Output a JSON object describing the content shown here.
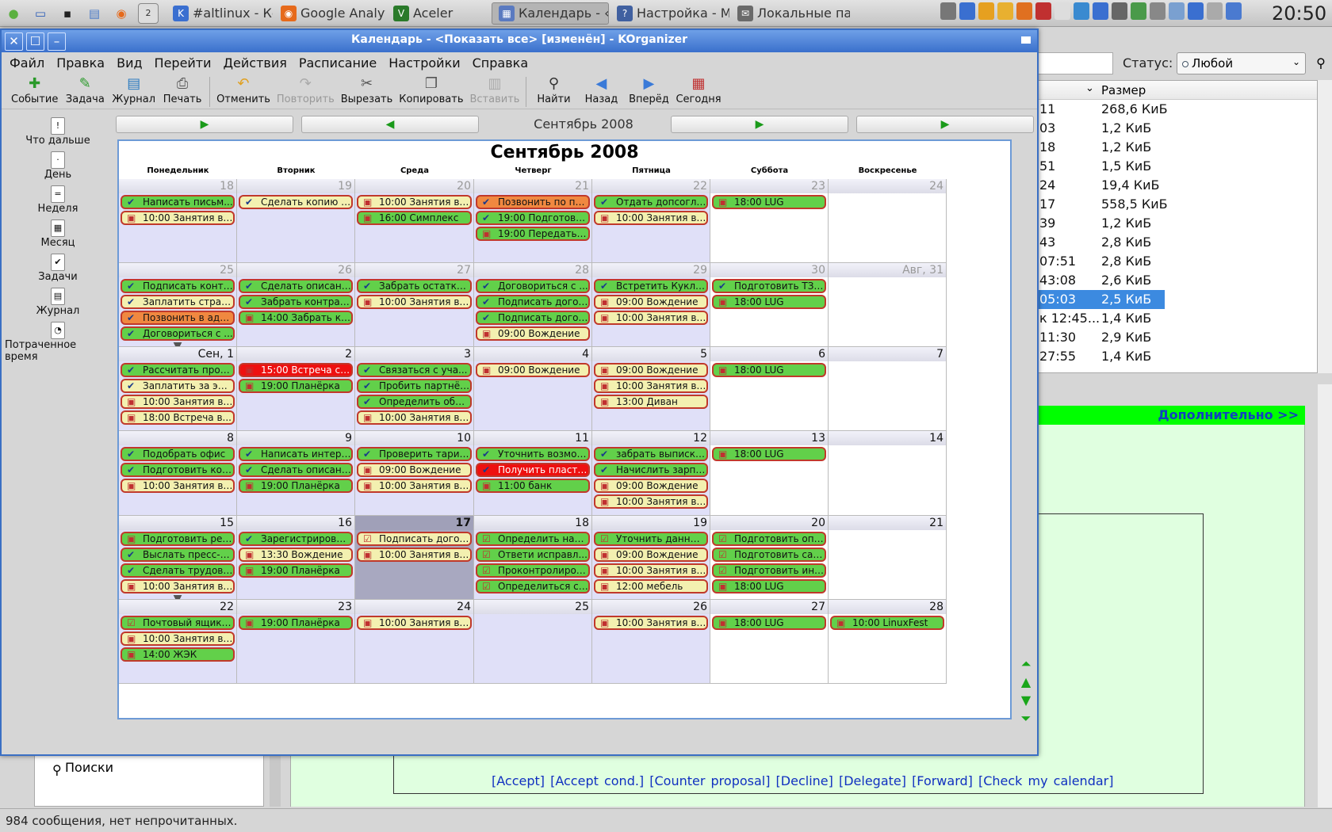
{
  "taskbar": {
    "tasks": [
      {
        "label": "#altlinux - Ко",
        "color": "#3a6fd0",
        "glyph": "K"
      },
      {
        "label": "Google Analyti",
        "color": "#e66a1b",
        "glyph": "◉"
      },
      {
        "label": "Aceler",
        "color": "#2a7a2a",
        "glyph": "V"
      },
      {
        "label": "Календарь - ‹",
        "color": "#5a7ac0",
        "glyph": "▦"
      },
      {
        "label": "Настройка - М",
        "color": "#4060a0",
        "glyph": "?"
      },
      {
        "label": "Локальные па",
        "color": "#6a6a6a",
        "glyph": "✉"
      }
    ],
    "launchers": [
      {
        "name": "os-logo-icon",
        "glyph": "●",
        "color": "#5bb040"
      },
      {
        "name": "desktop-icon",
        "glyph": "▭",
        "color": "#2b5db8"
      },
      {
        "name": "terminal-icon",
        "glyph": "▪",
        "color": "#222"
      },
      {
        "name": "files-icon",
        "glyph": "▤",
        "color": "#4a7ac8"
      },
      {
        "name": "browser-icon",
        "glyph": "◉",
        "color": "#e66a1b"
      }
    ],
    "pager_number": "2",
    "clock": "20:50"
  },
  "background": {
    "status_label": "Статус:",
    "status_value": "Любой",
    "size_header": "Размер",
    "rows": [
      {
        "c1": "11",
        "c2": "268,6 КиБ"
      },
      {
        "c1": "03",
        "c2": "1,2 КиБ"
      },
      {
        "c1": "18",
        "c2": "1,2 КиБ"
      },
      {
        "c1": "51",
        "c2": "1,5 КиБ"
      },
      {
        "c1": "24",
        "c2": "19,4 КиБ"
      },
      {
        "c1": "17",
        "c2": "558,5 КиБ"
      },
      {
        "c1": "39",
        "c2": "1,2 КиБ"
      },
      {
        "c1": "43",
        "c2": "2,8 КиБ"
      },
      {
        "c1": "07:51",
        "c2": "2,8 КиБ"
      },
      {
        "c1": "43:08",
        "c2": "2,6 КиБ"
      },
      {
        "c1": "05:03",
        "c2": "2,5 КиБ",
        "selected": true
      },
      {
        "c1": "к 12:45...",
        "c2": "1,4 КиБ"
      },
      {
        "c1": "11:30",
        "c2": "2,9 КиБ"
      },
      {
        "c1": "27:55",
        "c2": "1,4 КиБ"
      }
    ],
    "more_link": "Дополнительно >>",
    "actions": "[Accept]  [Accept cond.]  [Counter proposal]  [Decline]  [Delegate]  [Forward]  [Check my calendar]",
    "folder": "Поиски",
    "statusbar": "984 сообщения, нет непрочитанных."
  },
  "window": {
    "title": "Календарь - <Показать все>  [изменён] - KOrganizer",
    "menu": [
      "Файл",
      "Правка",
      "Вид",
      "Перейти",
      "Действия",
      "Расписание",
      "Настройки",
      "Справка"
    ],
    "toolbar": [
      {
        "label": "Событие",
        "icon": "✚",
        "color": "#2a9a2a"
      },
      {
        "label": "Задача",
        "icon": "✎",
        "color": "#2a9a2a"
      },
      {
        "label": "Журнал",
        "icon": "▤",
        "color": "#2a7ac0"
      },
      {
        "label": "Печать",
        "icon": "⎙",
        "color": "#555"
      },
      {
        "sep": true
      },
      {
        "label": "Отменить",
        "icon": "↶",
        "color": "#e0a020"
      },
      {
        "label": "Повторить",
        "icon": "↷",
        "color": "#aaa",
        "disabled": true
      },
      {
        "label": "Вырезать",
        "icon": "✂",
        "color": "#555"
      },
      {
        "label": "Копировать",
        "icon": "❐",
        "color": "#555"
      },
      {
        "label": "Вставить",
        "icon": "▥",
        "color": "#aaa",
        "disabled": true
      },
      {
        "sep": true
      },
      {
        "label": "Найти",
        "icon": "⚲",
        "color": "#333"
      },
      {
        "label": "Назад",
        "icon": "◀",
        "color": "#3a7ad8"
      },
      {
        "label": "Вперёд",
        "icon": "▶",
        "color": "#3a7ad8"
      },
      {
        "label": "Сегодня",
        "icon": "▦",
        "color": "#c03030"
      }
    ],
    "sidebar": [
      {
        "label": "Что дальше",
        "glyph": "!"
      },
      {
        "label": "День",
        "glyph": "·"
      },
      {
        "label": "Неделя",
        "glyph": "="
      },
      {
        "label": "Месяц",
        "glyph": "▦"
      },
      {
        "label": "Задачи",
        "glyph": "✔"
      },
      {
        "label": "Журнал",
        "glyph": "▤"
      },
      {
        "label": "Потраченное время",
        "glyph": "◔"
      }
    ],
    "nav_month": "Сентябрь 2008",
    "calendar_title": "Сентябрь 2008",
    "day_names": [
      "Понедельник",
      "Вторник",
      "Среда",
      "Четверг",
      "Пятница",
      "Суббота",
      "Воскресенье"
    ],
    "weeks": [
      [
        {
          "d": "18",
          "prev": true,
          "ev": [
            [
              "g",
              "t",
              "Написать письм..."
            ],
            [
              "y",
              "e",
              "10:00 Занятия в ..."
            ]
          ]
        },
        {
          "d": "19",
          "prev": true,
          "ev": [
            [
              "y",
              "t",
              "Сделать копию с..."
            ]
          ]
        },
        {
          "d": "20",
          "prev": true,
          "ev": [
            [
              "y",
              "e",
              "10:00 Занятия в ..."
            ],
            [
              "g",
              "e",
              "16:00 Симплекс"
            ]
          ]
        },
        {
          "d": "21",
          "prev": true,
          "ev": [
            [
              "o",
              "t",
              "Позвонить по по..."
            ],
            [
              "g",
              "t",
              "19:00 Подготовит..."
            ],
            [
              "g",
              "e",
              "19:00 Передать ..."
            ]
          ]
        },
        {
          "d": "22",
          "prev": true,
          "ev": [
            [
              "g",
              "t",
              "Отдать допсогла..."
            ],
            [
              "y",
              "e",
              "10:00 Занятия в ..."
            ]
          ]
        },
        {
          "d": "23",
          "prev": true,
          "we": true,
          "ev": [
            [
              "g",
              "e",
              "18:00 LUG"
            ]
          ]
        },
        {
          "d": "24",
          "prev": true,
          "we": true,
          "ev": []
        }
      ],
      [
        {
          "d": "25",
          "prev": true,
          "ev": [
            [
              "g",
              "t",
              "Подписать контр..."
            ],
            [
              "y",
              "t",
              "Заплатить страх..."
            ],
            [
              "o",
              "t",
              "Позвонить в адм..."
            ],
            [
              "g",
              "t",
              "Договориться с ..."
            ]
          ],
          "more": true
        },
        {
          "d": "26",
          "prev": true,
          "ev": [
            [
              "g",
              "t",
              "Сделать описани..."
            ],
            [
              "g",
              "t",
              "Забрать контракт..."
            ],
            [
              "g",
              "e",
              "14:00 Забрать ко..."
            ]
          ]
        },
        {
          "d": "27",
          "prev": true,
          "ev": [
            [
              "g",
              "t",
              "Забрать остатки ..."
            ],
            [
              "y",
              "e",
              "10:00 Занятия в ..."
            ]
          ]
        },
        {
          "d": "28",
          "prev": true,
          "ev": [
            [
              "g",
              "t",
              "Договориться с ..."
            ],
            [
              "g",
              "t",
              "Подписать догов..."
            ],
            [
              "g",
              "t",
              "Подписать догов..."
            ],
            [
              "y",
              "e",
              "09:00 Вождение"
            ]
          ]
        },
        {
          "d": "29",
          "prev": true,
          "ev": [
            [
              "g",
              "t",
              "Встретить Куклина"
            ],
            [
              "y",
              "e",
              "09:00 Вождение"
            ],
            [
              "y",
              "e",
              "10:00 Занятия в ..."
            ]
          ]
        },
        {
          "d": "30",
          "prev": true,
          "we": true,
          "ev": [
            [
              "g",
              "t",
              "Подготовить ТЗ ..."
            ],
            [
              "g",
              "e",
              "18:00 LUG"
            ]
          ]
        },
        {
          "d": "Авг, 31",
          "prev": true,
          "we": true,
          "ev": []
        }
      ],
      [
        {
          "d": "Сен, 1",
          "ev": [
            [
              "g",
              "t",
              "Рассчитать прое..."
            ],
            [
              "y",
              "t",
              "Заплатить за эле..."
            ],
            [
              "y",
              "e",
              "10:00 Занятия в ..."
            ],
            [
              "y",
              "e",
              "18:00 Встреча в..."
            ]
          ]
        },
        {
          "d": "2",
          "ev": [
            [
              "r",
              "e",
              "15:00 Встреча с ..."
            ],
            [
              "g",
              "e",
              "19:00 Планёрка"
            ]
          ]
        },
        {
          "d": "3",
          "ev": [
            [
              "g",
              "t",
              "Связаться с уча..."
            ],
            [
              "g",
              "t",
              "Пробить партнёр..."
            ],
            [
              "g",
              "t",
              "Определить объ..."
            ],
            [
              "y",
              "e",
              "10:00 Занятия в ..."
            ]
          ]
        },
        {
          "d": "4",
          "ev": [
            [
              "y",
              "e",
              "09:00 Вождение"
            ]
          ]
        },
        {
          "d": "5",
          "ev": [
            [
              "y",
              "e",
              "09:00 Вождение"
            ],
            [
              "y",
              "e",
              "10:00 Занятия в ..."
            ],
            [
              "y",
              "e",
              "13:00 Диван"
            ]
          ]
        },
        {
          "d": "6",
          "we": true,
          "ev": [
            [
              "g",
              "e",
              "18:00 LUG"
            ]
          ]
        },
        {
          "d": "7",
          "we": true,
          "ev": []
        }
      ],
      [
        {
          "d": "8",
          "ev": [
            [
              "g",
              "t",
              "Подобрать офис"
            ],
            [
              "g",
              "t",
              "Подготовить конт..."
            ],
            [
              "y",
              "e",
              "10:00 Занятия в ..."
            ]
          ]
        },
        {
          "d": "9",
          "ev": [
            [
              "g",
              "t",
              "Написать интервью"
            ],
            [
              "g",
              "t",
              "Сделать описани..."
            ],
            [
              "g",
              "e",
              "19:00 Планёрка"
            ]
          ]
        },
        {
          "d": "10",
          "ev": [
            [
              "g",
              "t",
              "Проверить тариф..."
            ],
            [
              "y",
              "e",
              "09:00 Вождение"
            ],
            [
              "y",
              "e",
              "10:00 Занятия в ..."
            ]
          ]
        },
        {
          "d": "11",
          "ev": [
            [
              "g",
              "t",
              "Уточнить возмож..."
            ],
            [
              "r",
              "t",
              "Получить пласти..."
            ],
            [
              "g",
              "e",
              "11:00 банк"
            ]
          ]
        },
        {
          "d": "12",
          "ev": [
            [
              "g",
              "t",
              "забрать выписки..."
            ],
            [
              "g",
              "t",
              "Начислить зарпл..."
            ],
            [
              "y",
              "e",
              "09:00 Вождение"
            ],
            [
              "y",
              "e",
              "10:00 Занятия в ..."
            ]
          ]
        },
        {
          "d": "13",
          "we": true,
          "ev": [
            [
              "g",
              "e",
              "18:00 LUG"
            ]
          ]
        },
        {
          "d": "14",
          "we": true,
          "ev": []
        }
      ],
      [
        {
          "d": "15",
          "ev": [
            [
              "g",
              "e",
              "Подготовить реш..."
            ],
            [
              "g",
              "t",
              "Выслать пресс-р..."
            ],
            [
              "g",
              "t",
              "Сделать трудово..."
            ],
            [
              "y",
              "e",
              "10:00 Занятия в ..."
            ]
          ],
          "more": true
        },
        {
          "d": "16",
          "ev": [
            [
              "g",
              "t",
              "Зарегистрироват..."
            ],
            [
              "y",
              "e",
              "13:30 Вождение"
            ],
            [
              "g",
              "e",
              "19:00 Планёрка"
            ]
          ]
        },
        {
          "d": "17",
          "today": true,
          "ev": [
            [
              "y",
              "c",
              "Подписать догов..."
            ],
            [
              "y",
              "e",
              "10:00 Занятия в ..."
            ]
          ]
        },
        {
          "d": "18",
          "shade": true,
          "ev": [
            [
              "g",
              "c",
              "Определить наб..."
            ],
            [
              "g",
              "c",
              "Ответи исправл..."
            ],
            [
              "g",
              "c",
              "Проконтролиров..."
            ],
            [
              "g",
              "c",
              "Определиться с ..."
            ]
          ]
        },
        {
          "d": "19",
          "ev": [
            [
              "g",
              "c",
              "Уточнить данные..."
            ],
            [
              "y",
              "e",
              "09:00 Вождение"
            ],
            [
              "y",
              "e",
              "10:00 Занятия в ..."
            ],
            [
              "y",
              "e",
              "12:00 мебель"
            ]
          ]
        },
        {
          "d": "20",
          "we": true,
          "ev": [
            [
              "g",
              "c",
              "Подготовить опи..."
            ],
            [
              "g",
              "c",
              "Подготовить сай..."
            ],
            [
              "g",
              "c",
              "Подготовить инс..."
            ],
            [
              "g",
              "e",
              "18:00 LUG"
            ]
          ]
        },
        {
          "d": "21",
          "we": true,
          "ev": []
        }
      ],
      [
        {
          "d": "22",
          "ev": [
            [
              "g",
              "c",
              "Почтовый ящик: ..."
            ],
            [
              "y",
              "e",
              "10:00 Занятия в ..."
            ],
            [
              "g",
              "e",
              "14:00 ЖЭК"
            ]
          ]
        },
        {
          "d": "23",
          "ev": [
            [
              "g",
              "e",
              "19:00 Планёрка"
            ]
          ]
        },
        {
          "d": "24",
          "ev": [
            [
              "y",
              "e",
              "10:00 Занятия в ..."
            ]
          ]
        },
        {
          "d": "25",
          "ev": []
        },
        {
          "d": "26",
          "ev": [
            [
              "y",
              "e",
              "10:00 Занятия в ..."
            ]
          ]
        },
        {
          "d": "27",
          "we": true,
          "ev": [
            [
              "g",
              "e",
              "18:00 LUG"
            ]
          ]
        },
        {
          "d": "28",
          "we": true,
          "ev": [
            [
              "g",
              "e",
              "10:00 LinuxFest"
            ]
          ]
        }
      ]
    ]
  }
}
